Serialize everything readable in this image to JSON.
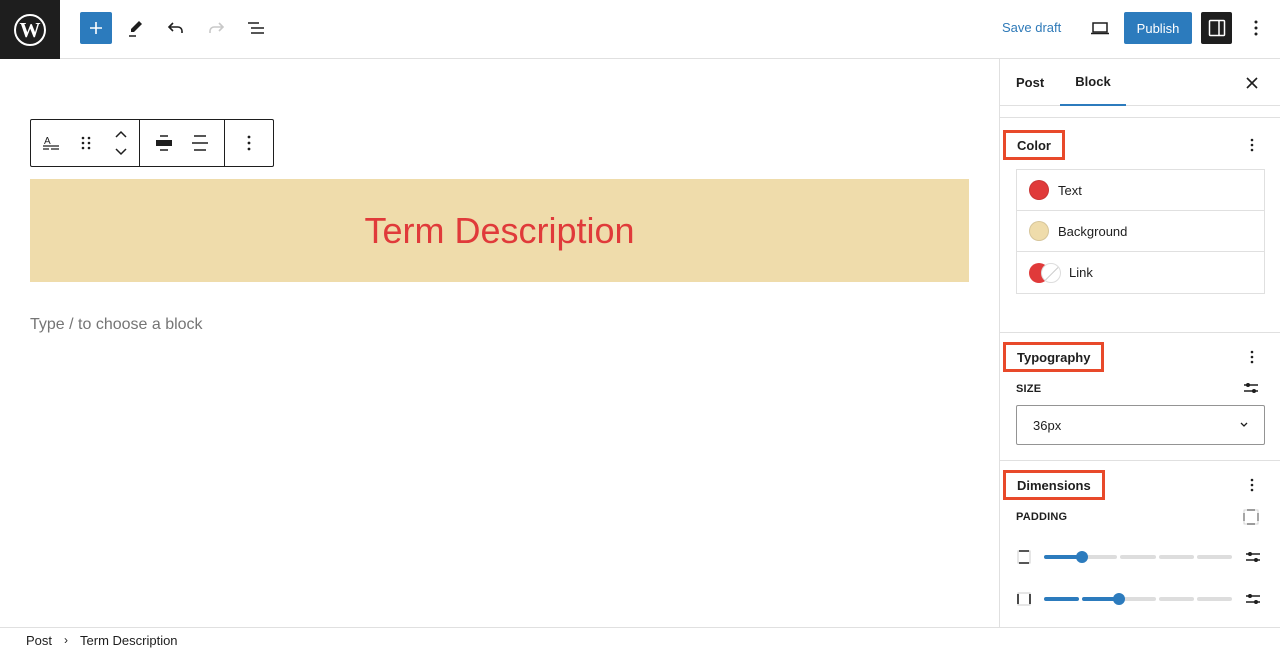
{
  "header": {
    "logo": "wordpress-logo",
    "add_block_label": "+",
    "save_draft_label": "Save draft",
    "publish_label": "Publish",
    "icons": [
      "plus-icon",
      "pencil-icon",
      "undo-icon",
      "redo-icon",
      "list-view-icon",
      "desktop-preview-icon",
      "sidebar-toggle-icon",
      "more-vertical-icon"
    ]
  },
  "block_toolbar": {
    "buttons": [
      "text-style-icon",
      "drag-handle-icon",
      "move-up-down-icon",
      "justify-stretch-icon",
      "align-center-icon",
      "more-options-icon"
    ]
  },
  "canvas": {
    "block_text": "Term Description",
    "block_text_color": "#e03a3a",
    "block_background_color": "#efdcab",
    "placeholder": "Type / to choose a block"
  },
  "sidebar": {
    "tabs": [
      {
        "label": "Post",
        "active": false
      },
      {
        "label": "Block",
        "active": true
      }
    ],
    "color_panel": {
      "title": "Color",
      "items": [
        {
          "label": "Text",
          "color": "#e03a3a"
        },
        {
          "label": "Background",
          "color": "#efdcab"
        },
        {
          "label": "Link",
          "color": "#e03a3a"
        }
      ]
    },
    "typography_panel": {
      "title": "Typography",
      "size_label": "SIZE",
      "size_value": "36px"
    },
    "dimensions_panel": {
      "title": "Dimensions",
      "padding_label": "PADDING",
      "sliders": [
        {
          "name": "vertical",
          "value_fraction": 0.2
        },
        {
          "name": "horizontal",
          "value_fraction": 0.4
        }
      ]
    }
  },
  "footer": {
    "breadcrumbs": [
      "Post",
      "Term Description"
    ]
  }
}
